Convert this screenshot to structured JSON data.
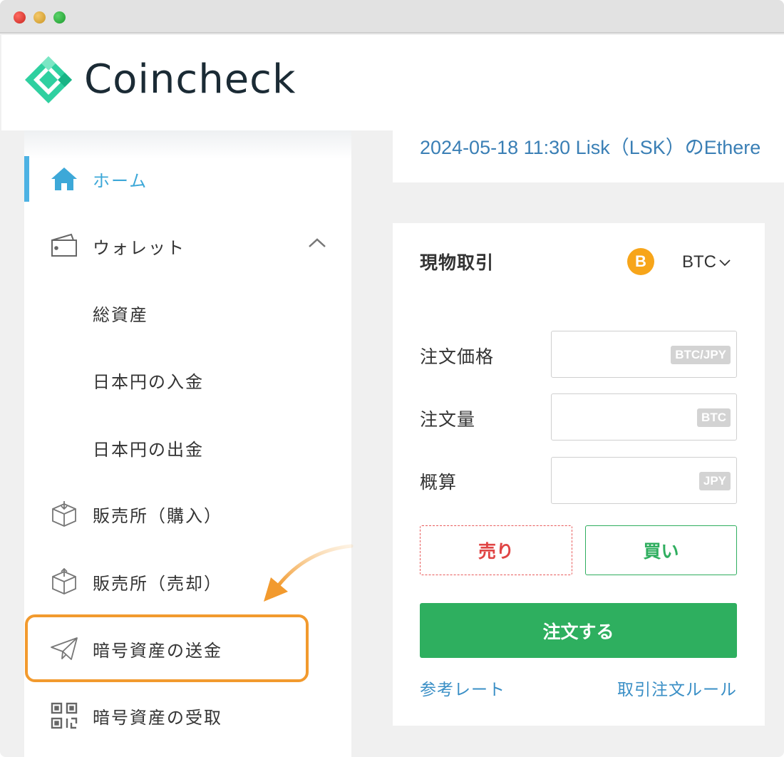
{
  "brand": {
    "name": "Coincheck",
    "mark_color": "#2fd0a0",
    "text_color": "#1b2b35"
  },
  "titlebar": {
    "buttons": [
      "close",
      "minimize",
      "zoom"
    ]
  },
  "sidebar": {
    "items": [
      {
        "label": "ホーム",
        "icon": "home-icon",
        "active": true
      },
      {
        "label": "ウォレット",
        "icon": "wallet-icon",
        "expanded": true
      },
      {
        "label": "総資産"
      },
      {
        "label": "日本円の入金"
      },
      {
        "label": "日本円の出金"
      },
      {
        "label": "販売所（購入）",
        "icon": "box-in-icon"
      },
      {
        "label": "販売所（売却）",
        "icon": "box-out-icon"
      },
      {
        "label": "暗号資産の送金",
        "icon": "paper-plane-icon",
        "highlighted": true
      },
      {
        "label": "暗号資産の受取",
        "icon": "qr-code-icon"
      }
    ],
    "highlight_color": "#f29a2e",
    "active_color": "#4db2e3"
  },
  "news": {
    "text": "2024-05-18 11:30 Lisk（LSK）のEthere"
  },
  "trade": {
    "title": "現物取引",
    "coin_symbol": "B",
    "pair": "BTC",
    "fields": [
      {
        "label": "注文価格",
        "unit": "BTC/JPY"
      },
      {
        "label": "注文量",
        "unit": "BTC"
      },
      {
        "label": "概算",
        "unit": "JPY"
      }
    ],
    "sell_label": "売り",
    "buy_label": "買い",
    "order_label": "注文する",
    "reference_rate_link": "参考レート",
    "rules_link": "取引注文ルール",
    "colors": {
      "sell": "#e04545",
      "buy": "#2fae5f",
      "order": "#2eaf5f",
      "link": "#3a8fc6"
    }
  }
}
